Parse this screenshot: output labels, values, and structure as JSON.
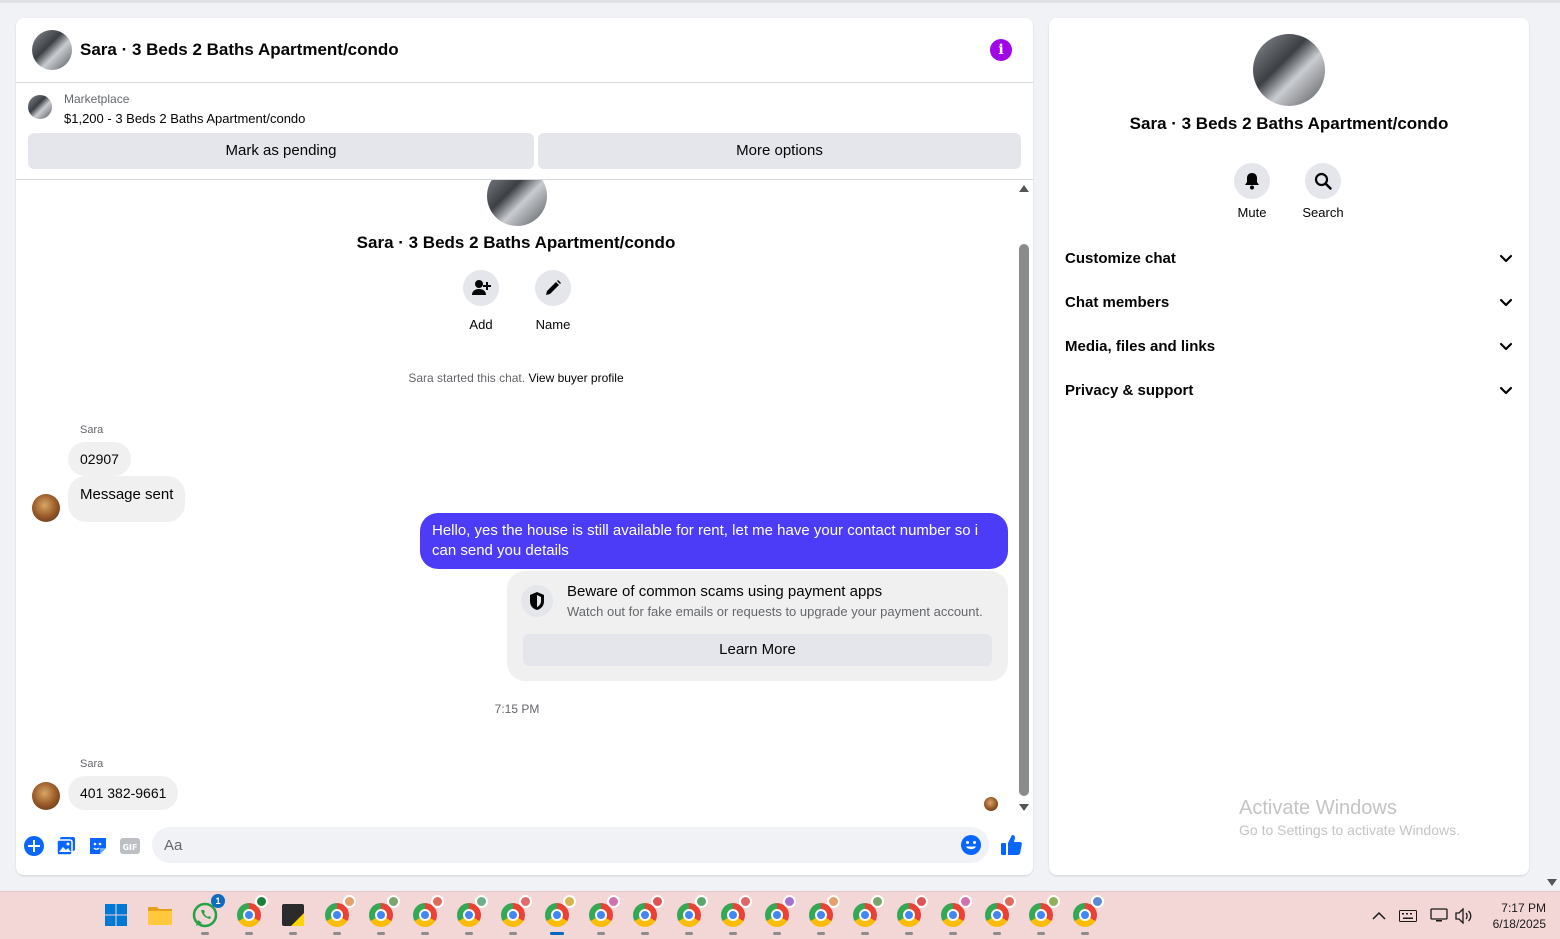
{
  "chat": {
    "title": "Sara · 3 Beds 2 Baths Apartment/condo",
    "info_icon": "info-icon"
  },
  "marketplace": {
    "label": "Marketplace",
    "listing": "$1,200 - 3 Beds 2 Baths Apartment/condo",
    "pending_label": "Mark as pending",
    "more_label": "More options"
  },
  "conversation": {
    "title": "Sara · 3 Beds 2 Baths Apartment/condo",
    "actions": [
      {
        "label": "Add",
        "icon": "add-person-icon"
      },
      {
        "label": "Name",
        "icon": "pencil-icon"
      }
    ],
    "started_text": "Sara started this chat.",
    "buyer_profile_link": "View buyer profile"
  },
  "messages": {
    "group1_sender": "Sara",
    "group1": [
      "02907",
      "Message sent"
    ],
    "outgoing": "Hello, yes the house is still available for rent, let me have your contact number so i can send you  details",
    "scam_notice": {
      "title": "Beware of common scams using payment apps",
      "subtitle": "Watch out for fake emails or requests to upgrade your payment account.",
      "button": "Learn More"
    },
    "timestamp": "7:15 PM",
    "group2_sender": "Sara",
    "group2": [
      "401 382-9661"
    ]
  },
  "composer": {
    "placeholder": "Aa",
    "icons": [
      "plus-icon",
      "photo-icon",
      "sticker-icon",
      "gif-icon",
      "emoji-icon",
      "thumbs-up-icon"
    ]
  },
  "info_panel": {
    "title": "Sara · 3 Beds 2 Baths Apartment/condo",
    "actions": [
      {
        "label": "Mute",
        "icon": "bell-icon"
      },
      {
        "label": "Search",
        "icon": "search-icon"
      }
    ],
    "sections": [
      "Customize chat",
      "Chat members",
      "Media, files and links",
      "Privacy & support"
    ]
  },
  "watermark": {
    "line1": "Activate Windows",
    "line2": "Go to Settings to activate Windows."
  },
  "taskbar": {
    "whatsapp_badge": "1",
    "time": "7:17 PM",
    "date": "6/18/2025"
  },
  "colors": {
    "accent": "#a007e6",
    "outgoing_bubble": "#4c3cf7",
    "messenger_blue": "#0866ff",
    "taskbar": "#f3d6d6"
  }
}
